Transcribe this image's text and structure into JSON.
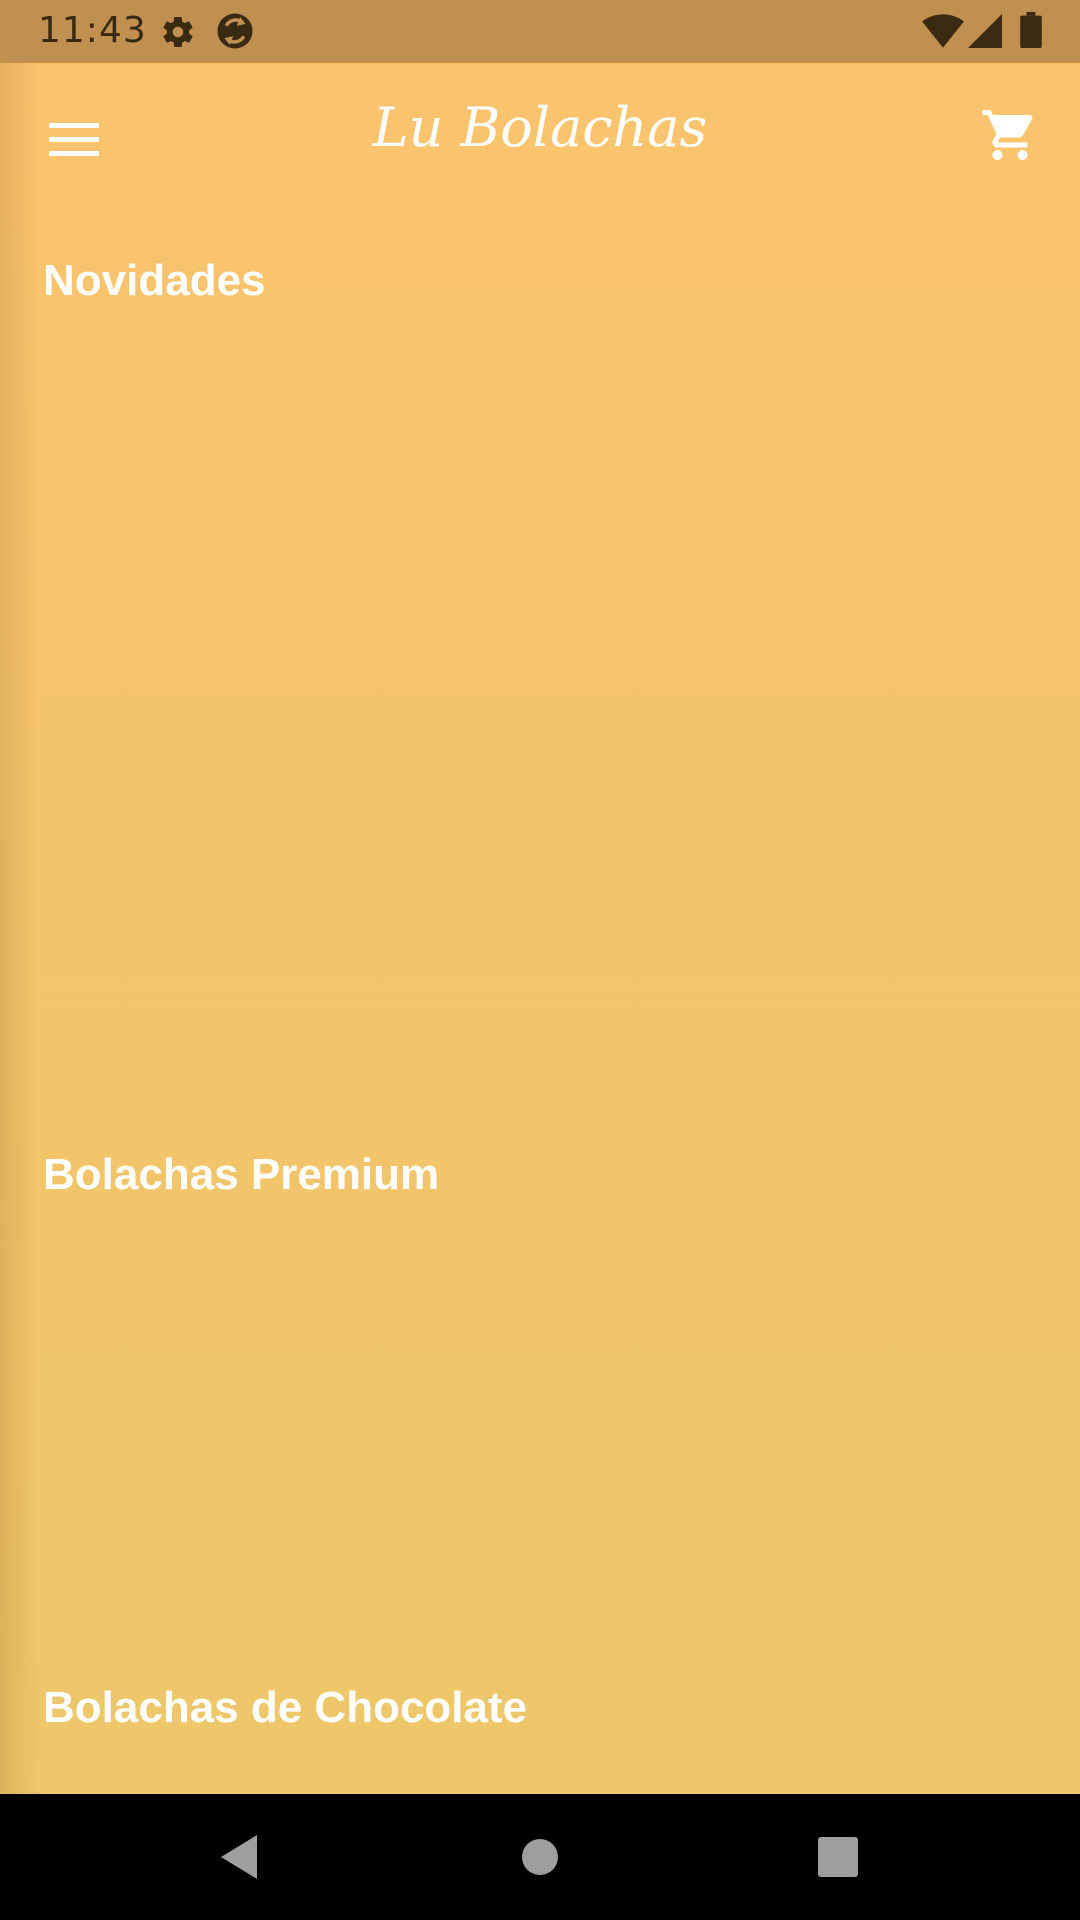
{
  "status_bar": {
    "time": "11:43",
    "icons": [
      "gear-icon",
      "sync-icon",
      "wifi-icon",
      "signal-icon",
      "battery-icon"
    ]
  },
  "app_bar": {
    "title": "Lu Bolachas",
    "left_icon": "menu-icon",
    "right_icon": "cart-icon"
  },
  "sections": [
    {
      "title": "Novidades"
    },
    {
      "title": "Bolachas Premium"
    },
    {
      "title": "Bolachas de Chocolate"
    }
  ],
  "nav_bar": {
    "buttons": [
      "back-icon",
      "home-icon",
      "recents-icon"
    ]
  },
  "colors": {
    "status_bar": "#bf9050",
    "background_top": "#fbc36e",
    "background_bottom": "#eec76a",
    "text": "#ffffff"
  }
}
